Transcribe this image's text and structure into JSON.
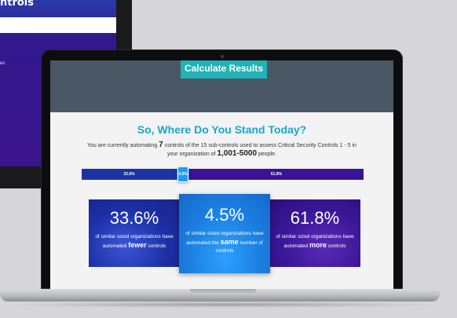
{
  "background_monitor": {
    "title": "ntrols",
    "text": "es"
  },
  "hero": {
    "calculate_button": "Calculate Results"
  },
  "results": {
    "headline": "So, Where Do You Stand Today?",
    "sentence": {
      "prefix": "You are currently automating",
      "count": "7",
      "middle": "controls of the 15 sub-controls used to assess Critical Security Controls 1 - 5 in your organization of",
      "org_size": "1,001-5000",
      "suffix": "people."
    },
    "bar": {
      "fewer_label": "33.6%",
      "same_label": "4.5%",
      "more_label": "61.8%",
      "fewer_fraction": 0.336,
      "same_fraction": 0.045,
      "more_fraction": 0.618
    },
    "cards": [
      {
        "percent": "33.6%",
        "line1": "of similar sized organizations have",
        "pre": "automated",
        "keyword": "fewer",
        "post": "controls"
      },
      {
        "percent": "4.5%",
        "line1": "of similar sized organizations have",
        "pre": "automated the",
        "keyword": "same",
        "post": "number of controls"
      },
      {
        "percent": "61.8%",
        "line1": "of similar sized organizations have",
        "pre": "automated",
        "keyword": "more",
        "post": "controls"
      }
    ]
  },
  "colors": {
    "accent_teal": "#1fb3b7",
    "headline_blue": "#1ea6c9",
    "fewer_blue": "#1c33a6",
    "same_blue": "#1b8ee6",
    "more_purple": "#3a1298"
  }
}
